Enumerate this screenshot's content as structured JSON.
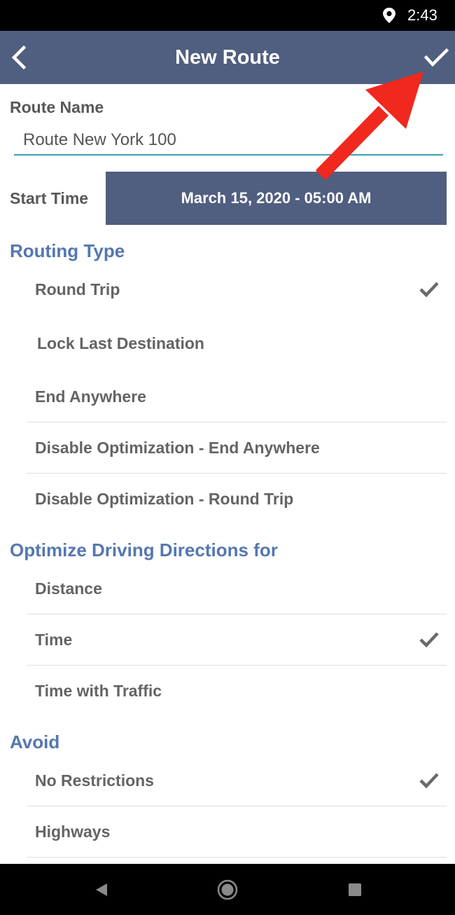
{
  "status_bar": {
    "time": "2:43",
    "icons": [
      "location-pin-icon"
    ]
  },
  "app_bar": {
    "title": "New Route",
    "back_icon": "chevron-left-icon",
    "done_icon": "check-icon"
  },
  "route_name": {
    "label": "Route Name",
    "value": "Route New York 100"
  },
  "start_time": {
    "label": "Start Time",
    "value": "March 15, 2020 - 05:00 AM"
  },
  "routing_type": {
    "heading": "Routing Type",
    "options": [
      {
        "label": "Round Trip",
        "selected": true
      },
      {
        "label": "Lock Last Destination",
        "selected": false
      },
      {
        "label": "End Anywhere",
        "selected": false
      },
      {
        "label": "Disable Optimization - End Anywhere",
        "selected": false
      },
      {
        "label": "Disable Optimization - Round Trip",
        "selected": false
      }
    ]
  },
  "optimize": {
    "heading": "Optimize Driving Directions for",
    "options": [
      {
        "label": "Distance",
        "selected": false
      },
      {
        "label": "Time",
        "selected": true
      },
      {
        "label": "Time with Traffic",
        "selected": false
      }
    ]
  },
  "avoid": {
    "heading": "Avoid",
    "options": [
      {
        "label": "No Restrictions",
        "selected": true
      },
      {
        "label": "Highways",
        "selected": false
      }
    ]
  },
  "nav_bar": {
    "icons": [
      "back-triangle-icon",
      "home-circle-icon",
      "recents-square-icon"
    ]
  },
  "colors": {
    "app_bar": "#505e80",
    "section_heading": "#5577b0",
    "annotation_arrow": "#f0281e",
    "input_underline": "#3aa0b8"
  }
}
